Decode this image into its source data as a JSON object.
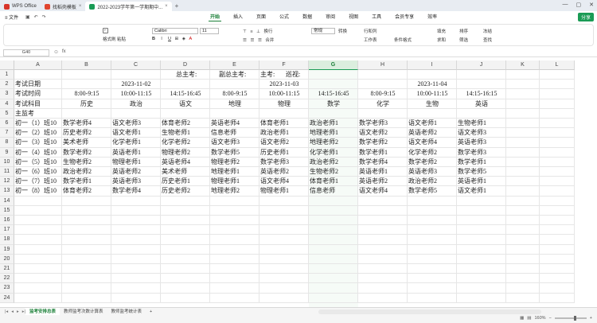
{
  "window": {
    "tabs": [
      {
        "label": "WPS Office",
        "icon_color": "#d8352a"
      },
      {
        "label": "找稻壳模板",
        "icon_color": "#e0452f"
      },
      {
        "label": "2022-2023学年第一学期期中...",
        "icon_color": "#1a9b55"
      }
    ],
    "new_tab": "+"
  },
  "menu": {
    "file": "≡ 文件",
    "items": [
      "开始",
      "插入",
      "页面",
      "公式",
      "数据",
      "审阅",
      "视图",
      "工具",
      "会员专享",
      "效率"
    ],
    "active": "开始",
    "share": "分享"
  },
  "ribbon": {
    "format_painter": "格式刷",
    "paste": "粘贴",
    "font_name": "Calibri",
    "font_size": "11",
    "wrap": "换行",
    "merge": "合并",
    "number_format": "常规",
    "convert": "转换",
    "row_col": "行和列",
    "worksheet": "工作表",
    "cond_format": "条件格式",
    "fill": "填充",
    "sort": "排序",
    "freeze": "冻结",
    "sum": "求和",
    "filter": "筛选",
    "find": "查找"
  },
  "formula_bar": {
    "name_box": "G40",
    "fx": "fx"
  },
  "columns": [
    "A",
    "B",
    "C",
    "D",
    "E",
    "F",
    "G",
    "H",
    "I",
    "J",
    "K",
    "L"
  ],
  "selected_column": "G",
  "rows": [
    {
      "n": "1",
      "cells": [
        {
          "c": 3,
          "t": "总主考:",
          "span": 1,
          "off": 18
        },
        {
          "c": 4,
          "t": "副总主考:",
          "off": 10
        },
        {
          "c": 5,
          "t": "主考:",
          "off": 0
        },
        {
          "c": 6,
          "t": "巡视:",
          "off": -30
        }
      ]
    },
    {
      "n": "2",
      "cells": [
        {
          "c": 0,
          "t": "考试日期"
        },
        {
          "c": 2,
          "t": "2023-11-02",
          "center": true
        },
        {
          "c": 5,
          "t": "2023-11-03",
          "center": true
        },
        {
          "c": 8,
          "t": "2023-11-04",
          "center": true
        }
      ]
    },
    {
      "n": "3",
      "cells": [
        {
          "c": 0,
          "t": "考试时间"
        },
        {
          "c": 1,
          "t": "8:00-9:15",
          "center": true
        },
        {
          "c": 2,
          "t": "10:00-11:15",
          "center": true
        },
        {
          "c": 3,
          "t": "14:15-16:45",
          "center": true
        },
        {
          "c": 4,
          "t": "8:00-9:15",
          "center": true
        },
        {
          "c": 5,
          "t": "10:00-11:15",
          "center": true
        },
        {
          "c": 6,
          "t": "14:15-16:45",
          "center": true
        },
        {
          "c": 7,
          "t": "8:00-9:15",
          "center": true
        },
        {
          "c": 8,
          "t": "10:00-11:15",
          "center": true
        },
        {
          "c": 9,
          "t": "14:15-16:15",
          "center": true
        }
      ]
    },
    {
      "n": "4",
      "cells": [
        {
          "c": 0,
          "t": "考试科目"
        },
        {
          "c": 1,
          "t": "历史",
          "center": true
        },
        {
          "c": 2,
          "t": "政治",
          "center": true
        },
        {
          "c": 3,
          "t": "语文",
          "center": true
        },
        {
          "c": 4,
          "t": "地理",
          "center": true
        },
        {
          "c": 5,
          "t": "物理",
          "center": true
        },
        {
          "c": 6,
          "t": "数学",
          "center": true
        },
        {
          "c": 7,
          "t": "化学",
          "center": true
        },
        {
          "c": 8,
          "t": "生物",
          "center": true
        },
        {
          "c": 9,
          "t": "英语",
          "center": true
        }
      ]
    },
    {
      "n": "5",
      "cells": [
        {
          "c": 0,
          "t": "主监考"
        }
      ]
    },
    {
      "n": "6",
      "cells": [
        {
          "c": 0,
          "t": "初一（1）班10"
        },
        {
          "c": 1,
          "t": "数学老师4"
        },
        {
          "c": 2,
          "t": "语文老师3"
        },
        {
          "c": 3,
          "t": "体育老师2"
        },
        {
          "c": 4,
          "t": "英语老师4"
        },
        {
          "c": 5,
          "t": "体育老师1"
        },
        {
          "c": 6,
          "t": "政治老师1"
        },
        {
          "c": 7,
          "t": "数学老师3"
        },
        {
          "c": 8,
          "t": "语文老师1"
        },
        {
          "c": 9,
          "t": "生物老师1"
        }
      ]
    },
    {
      "n": "7",
      "cells": [
        {
          "c": 0,
          "t": "初一（2）班10"
        },
        {
          "c": 1,
          "t": "历史老师2"
        },
        {
          "c": 2,
          "t": "语文老师1"
        },
        {
          "c": 3,
          "t": "生物老师1"
        },
        {
          "c": 4,
          "t": "信息老师"
        },
        {
          "c": 5,
          "t": "政治老师1"
        },
        {
          "c": 6,
          "t": "地理老师1"
        },
        {
          "c": 7,
          "t": "语文老师2"
        },
        {
          "c": 8,
          "t": "英语老师2"
        },
        {
          "c": 9,
          "t": "语文老师3"
        }
      ]
    },
    {
      "n": "8",
      "cells": [
        {
          "c": 0,
          "t": "初一（3）班10"
        },
        {
          "c": 1,
          "t": "美术老师"
        },
        {
          "c": 2,
          "t": "化学老师1"
        },
        {
          "c": 3,
          "t": "化学老师2"
        },
        {
          "c": 4,
          "t": "语文老师3"
        },
        {
          "c": 5,
          "t": "语文老师2"
        },
        {
          "c": 6,
          "t": "地理老师2"
        },
        {
          "c": 7,
          "t": "数学老师2"
        },
        {
          "c": 8,
          "t": "语文老师4"
        },
        {
          "c": 9,
          "t": "英语老师3"
        }
      ]
    },
    {
      "n": "9",
      "cells": [
        {
          "c": 0,
          "t": "初一（4）班10"
        },
        {
          "c": 1,
          "t": "数学老师2"
        },
        {
          "c": 2,
          "t": "英语老师1"
        },
        {
          "c": 3,
          "t": "物理老师2"
        },
        {
          "c": 4,
          "t": "数学老师5"
        },
        {
          "c": 5,
          "t": "历史老师1"
        },
        {
          "c": 6,
          "t": "化学老师1"
        },
        {
          "c": 7,
          "t": "数学老师1"
        },
        {
          "c": 8,
          "t": "化学老师2"
        },
        {
          "c": 9,
          "t": "数学老师3"
        }
      ]
    },
    {
      "n": "10",
      "cells": [
        {
          "c": 0,
          "t": "初一（5）班10"
        },
        {
          "c": 1,
          "t": "生物老师2"
        },
        {
          "c": 2,
          "t": "物理老师1"
        },
        {
          "c": 3,
          "t": "英语老师4"
        },
        {
          "c": 4,
          "t": "物理老师2"
        },
        {
          "c": 5,
          "t": "数学老师3"
        },
        {
          "c": 6,
          "t": "政治老师2"
        },
        {
          "c": 7,
          "t": "数学老师4"
        },
        {
          "c": 8,
          "t": "数学老师2"
        },
        {
          "c": 9,
          "t": "数学老师1"
        }
      ]
    },
    {
      "n": "11",
      "cells": [
        {
          "c": 0,
          "t": "初一（6）班10"
        },
        {
          "c": 1,
          "t": "政治老师2"
        },
        {
          "c": 2,
          "t": "英语老师2"
        },
        {
          "c": 3,
          "t": "美术老师"
        },
        {
          "c": 4,
          "t": "地理老师1"
        },
        {
          "c": 5,
          "t": "英语老师2"
        },
        {
          "c": 6,
          "t": "生物老师2"
        },
        {
          "c": 7,
          "t": "英语老师1"
        },
        {
          "c": 8,
          "t": "英语老师3"
        },
        {
          "c": 9,
          "t": "数学老师5"
        }
      ]
    },
    {
      "n": "12",
      "cells": [
        {
          "c": 0,
          "t": "初一（7）班10"
        },
        {
          "c": 1,
          "t": "数学老师1"
        },
        {
          "c": 2,
          "t": "英语老师3"
        },
        {
          "c": 3,
          "t": "历史老师1"
        },
        {
          "c": 4,
          "t": "物理老师1"
        },
        {
          "c": 5,
          "t": "语文老师4"
        },
        {
          "c": 6,
          "t": "体育老师1"
        },
        {
          "c": 7,
          "t": "英语老师2"
        },
        {
          "c": 8,
          "t": "政治老师2"
        },
        {
          "c": 9,
          "t": "英语老师1"
        }
      ]
    },
    {
      "n": "13",
      "cells": [
        {
          "c": 0,
          "t": "初一（8）班10"
        },
        {
          "c": 1,
          "t": "体育老师2"
        },
        {
          "c": 2,
          "t": "数学老师4"
        },
        {
          "c": 3,
          "t": "历史老师2"
        },
        {
          "c": 4,
          "t": "地理老师2"
        },
        {
          "c": 5,
          "t": "物理老师1"
        },
        {
          "c": 6,
          "t": "信息老师"
        },
        {
          "c": 7,
          "t": "语文老师4"
        },
        {
          "c": 8,
          "t": "数学老师5"
        },
        {
          "c": 9,
          "t": "语文老师1"
        }
      ]
    },
    {
      "n": "14",
      "cells": []
    },
    {
      "n": "15",
      "cells": []
    },
    {
      "n": "16",
      "cells": []
    },
    {
      "n": "17",
      "cells": []
    },
    {
      "n": "18",
      "cells": []
    },
    {
      "n": "19",
      "cells": []
    },
    {
      "n": "20",
      "cells": []
    },
    {
      "n": "21",
      "cells": []
    },
    {
      "n": "22",
      "cells": []
    },
    {
      "n": "23",
      "cells": []
    },
    {
      "n": "24",
      "cells": []
    }
  ],
  "sheets": [
    "监考安排总表",
    "教师监考次数计算表",
    "教师监考统计表"
  ],
  "active_sheet": "监考安排总表",
  "add_sheet": "+",
  "zoom": "160%",
  "accent_color": "#1a9b55"
}
